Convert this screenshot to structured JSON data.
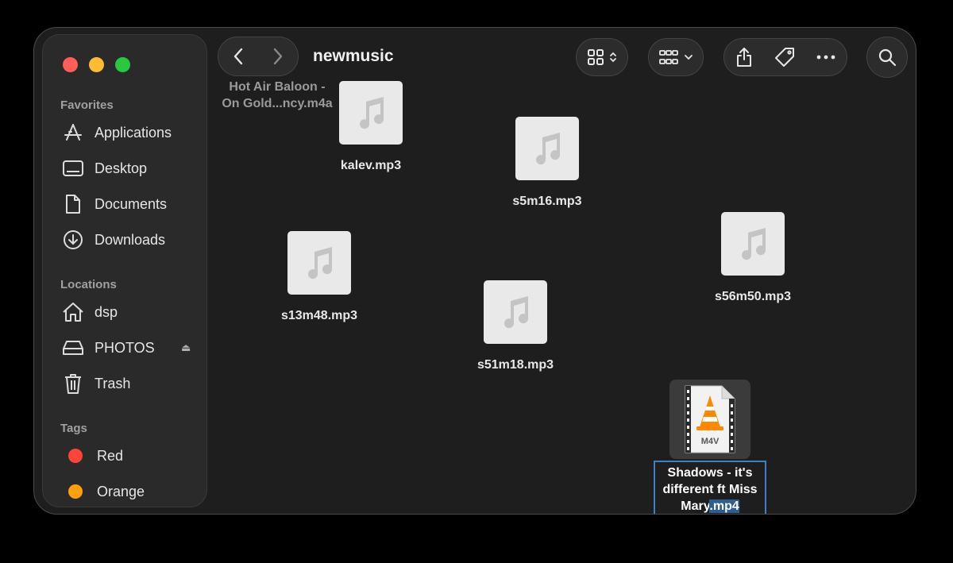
{
  "window": {
    "title": "newmusic"
  },
  "sidebar": {
    "favorites_header": "Favorites",
    "favorites": [
      {
        "label": "Applications",
        "icon": "applications-icon"
      },
      {
        "label": "Desktop",
        "icon": "desktop-icon"
      },
      {
        "label": "Documents",
        "icon": "document-icon"
      },
      {
        "label": "Downloads",
        "icon": "download-icon"
      }
    ],
    "locations_header": "Locations",
    "locations": [
      {
        "label": "dsp",
        "icon": "home-icon"
      },
      {
        "label": "PHOTOS",
        "icon": "drive-icon"
      },
      {
        "label": "Trash",
        "icon": "trash-icon"
      }
    ],
    "tags_header": "Tags",
    "tags": [
      {
        "label": "Red",
        "color": "#ff453a"
      },
      {
        "label": "Orange",
        "color": "#ff9f0a"
      }
    ]
  },
  "files": {
    "hot_air": {
      "line1": "Hot Air Baloon -",
      "line2": "On Gold...ncy.m4a"
    },
    "kalev": "kalev.mp3",
    "s5m16": "s5m16.mp3",
    "s13m48": "s13m48.mp3",
    "s51m18": "s51m18.mp3",
    "s56m50": "s56m50.mp3",
    "shadows": {
      "line1": "Shadows - it's",
      "line2": "different ft Miss",
      "line3_name": "Mary",
      "line3_ext": ".mp4",
      "badge": "M4V"
    }
  },
  "colors": {
    "accent": "#3b82c4",
    "selection_highlight": "#2c5d93",
    "window_bg": "#1e1e1e",
    "sidebar_bg": "#2a2a2a"
  }
}
